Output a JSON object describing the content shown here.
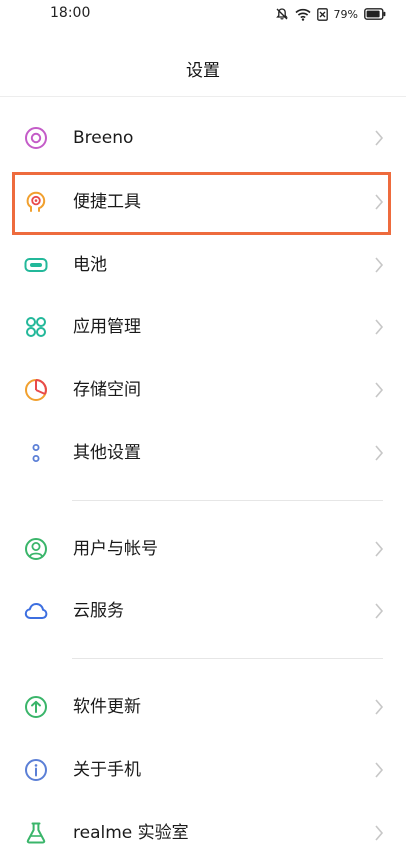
{
  "status": {
    "time": "18:00",
    "battery_pct": "79%"
  },
  "header": {
    "title": "设置"
  },
  "settings": [
    {
      "label": "Breeno",
      "icon": "breeno-icon",
      "color": "#c45cc8"
    },
    {
      "label": "便捷工具",
      "icon": "convenience-tools-icon",
      "color": "#f1a02e"
    },
    {
      "label": "电池",
      "icon": "battery-icon",
      "color": "#23b89a"
    },
    {
      "label": "应用管理",
      "icon": "app-management-icon",
      "color": "#23b89a"
    },
    {
      "label": "存储空间",
      "icon": "storage-icon",
      "color": "#f1a02e"
    },
    {
      "label": "其他设置",
      "icon": "other-settings-icon",
      "color": "#5b7fd6"
    },
    {
      "label": "用户与帐号",
      "icon": "user-account-icon",
      "color": "#3ab56a"
    },
    {
      "label": "云服务",
      "icon": "cloud-icon",
      "color": "#3d6fe0"
    },
    {
      "label": "软件更新",
      "icon": "software-update-icon",
      "color": "#3ab56a"
    },
    {
      "label": "关于手机",
      "icon": "about-phone-icon",
      "color": "#5b7fd6"
    },
    {
      "label": "realme 实验室",
      "icon": "lab-flask-icon",
      "color": "#3ab56a"
    }
  ],
  "highlight_color": "#ee6b3d"
}
